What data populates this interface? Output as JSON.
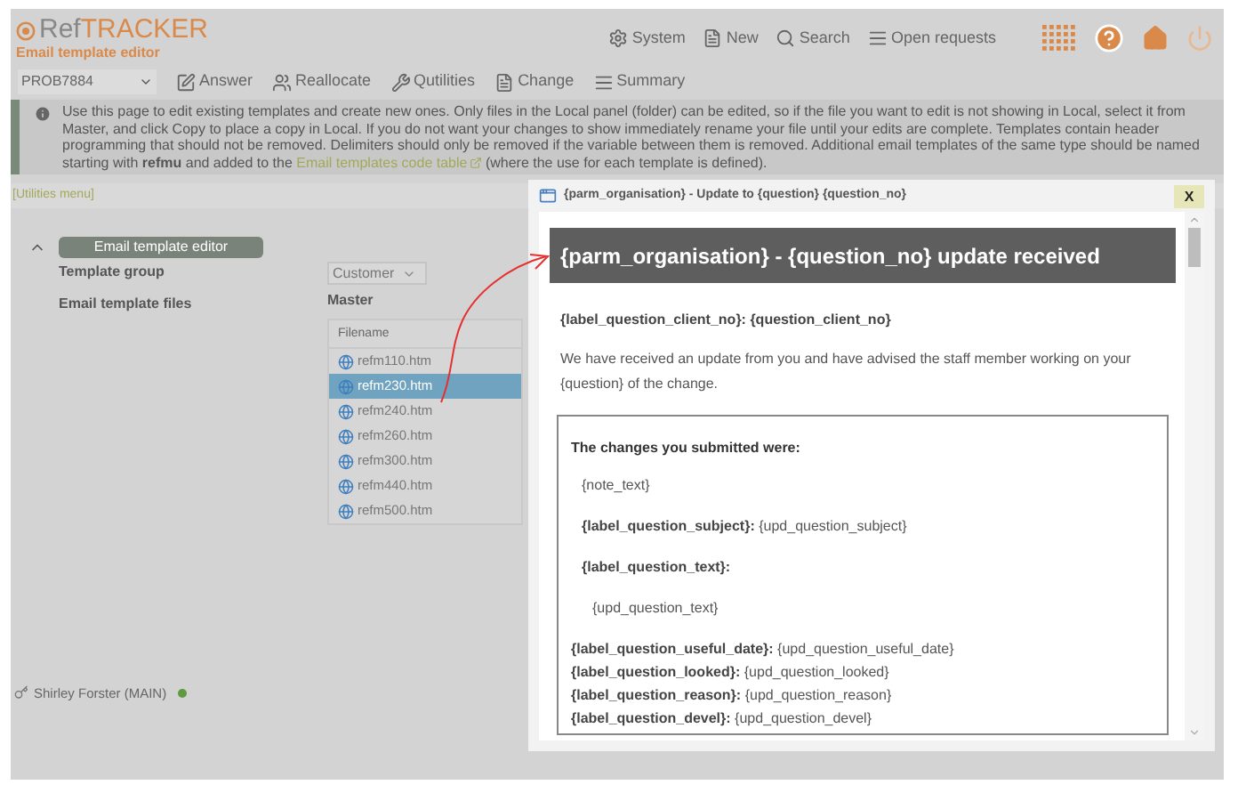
{
  "header": {
    "logo_prefix": "Ref",
    "logo_suffix": "TRACKER",
    "subtitle": "Email template editor",
    "nav": [
      {
        "label": "System"
      },
      {
        "label": "New"
      },
      {
        "label": "Search"
      },
      {
        "label": "Open requests"
      }
    ]
  },
  "toolbar": {
    "request": "PROB7884",
    "buttons": [
      {
        "label": "Answer"
      },
      {
        "label": "Reallocate"
      },
      {
        "label": "Qutilities"
      },
      {
        "label": "Change"
      },
      {
        "label": "Summary"
      }
    ]
  },
  "info": {
    "before": "Use this page to edit existing templates and create new ones. Only files in the Local panel (folder) can be edited, so if the file you want to edit is not showing in Local, select it from Master, and click Copy to place a copy in Local. If you do not want your changes to show immediately rename your file until your edits are complete. Templates contain header programming that should not be removed. Delimiters should only be removed if the variable between them is removed. Additional email templates of the same type should be named starting with **refmu** and added to the",
    "link": "Email templates code table",
    "after": "(where the use for each template is defined)."
  },
  "utilities_link": "[Utilities menu]",
  "editor": {
    "title": "Email template editor",
    "expanded": true,
    "group_label": "Template group",
    "group_value": "Customer",
    "files_label": "Email template files",
    "panel_title": "Master",
    "column": "Filename",
    "files": [
      {
        "name": "refm110.htm",
        "selected": false
      },
      {
        "name": "refm230.htm",
        "selected": true
      },
      {
        "name": "refm240.htm",
        "selected": false
      },
      {
        "name": "refm260.htm",
        "selected": false
      },
      {
        "name": "refm300.htm",
        "selected": false
      },
      {
        "name": "refm440.htm",
        "selected": false
      },
      {
        "name": "refm500.htm",
        "selected": false
      }
    ]
  },
  "user": {
    "name": "Shirley Forster (MAIN)",
    "color": "#5f9a3f"
  },
  "preview": {
    "title": "{parm_organisation} - Update to {question} {question_no}",
    "close": "X",
    "heading": "{parm_organisation} - {question_no} update received",
    "client_line": "{label_question_client_no}: {question_client_no}",
    "message": "We have received an update from you and have advised the staff member working on your {question} of the change.",
    "box": [
      {
        "kind": "heading",
        "text": "The changes you submitted were:"
      },
      {
        "kind": "plain",
        "text": "{note_text}"
      },
      {
        "kind": "field",
        "label": "{label_question_subject}:",
        "value": "{upd_question_subject}"
      },
      {
        "kind": "label",
        "text": "{label_question_text}:"
      },
      {
        "kind": "indented",
        "text": "{upd_question_text}"
      }
    ],
    "details": [
      {
        "label": "{label_question_useful_date}:",
        "value": "{upd_question_useful_date}"
      },
      {
        "label": "{label_question_looked}:",
        "value": "{upd_question_looked}"
      },
      {
        "label": "{label_question_reason}:",
        "value": "{upd_question_reason}"
      },
      {
        "label": "{label_question_devel}:",
        "value": "{upd_question_devel}"
      }
    ]
  }
}
